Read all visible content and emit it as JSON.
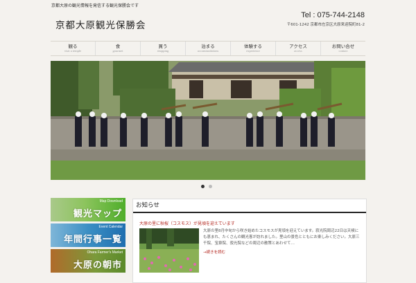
{
  "header": {
    "tagline": "京都大原の観光情報を発信する観光保勝会です",
    "logo": "京都大原観光保勝会",
    "tel": "Tel : 075-744-2148",
    "address": "〒601-1242 京都市左京区大原来迎院町81-2"
  },
  "nav": [
    {
      "ja": "観る",
      "en": "visit a temple"
    },
    {
      "ja": "食",
      "en": "gourmet"
    },
    {
      "ja": "買う",
      "en": "shopping"
    },
    {
      "ja": "泊まる",
      "en": "accommodations"
    },
    {
      "ja": "体験する",
      "en": "experience"
    },
    {
      "ja": "アクセス",
      "en": "access"
    },
    {
      "ja": "お問い合せ",
      "en": "contact"
    }
  ],
  "slider": {
    "active_index": 0,
    "count": 2
  },
  "banners": [
    {
      "small": "Map Download",
      "big": "観光マップ"
    },
    {
      "small": "Event Calendar",
      "big": "年間行事一覧"
    },
    {
      "small": "Ohara Farmer's Market",
      "big": "大原の朝市"
    }
  ],
  "news": {
    "heading": "お知らせ",
    "item_title": "大原の里に秋桜（コスモス）が見頃を迎えています",
    "item_body": "大原の里8月中旬から咲き始めたコスモスが見頃を迎えています。寂光院周辺22日は天候にも恵まれ、たくさんの観光客が訪れました。里山の景色とともにお楽しみください。大原三千院、宝泉院、寂光院などの周辺の散策とあわせて…",
    "read_more": "→続きを読む"
  },
  "colors": {
    "accent": "#b3261e",
    "background": "#f4f2ee"
  }
}
